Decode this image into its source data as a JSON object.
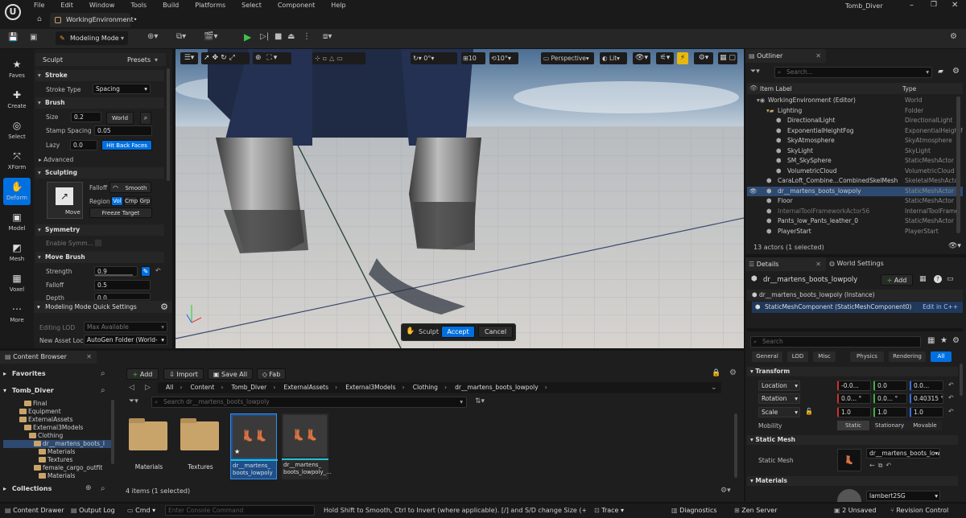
{
  "menu": {
    "items": [
      "File",
      "Edit",
      "Window",
      "Tools",
      "Build",
      "Platforms",
      "Select",
      "Component",
      "Help"
    ],
    "project": "Tomb_Diver",
    "tab": "WorkingEnvironment•"
  },
  "toolbar": {
    "mode": "Modeling Mode"
  },
  "left_tools": [
    "Faves",
    "Create",
    "Select",
    "XForm",
    "Deform",
    "Model",
    "Mesh",
    "Voxel",
    "More"
  ],
  "sculpt": {
    "title": "Sculpt",
    "presets": "Presets",
    "stroke": "Stroke",
    "stroke_type_label": "Stroke Type",
    "stroke_type": "Spacing",
    "brush": "Brush",
    "size_label": "Size",
    "size": "0.2",
    "world": "World",
    "stamp_label": "Stamp Spacing",
    "stamp": "0.05",
    "lazy_label": "Lazy",
    "lazy": "0.0",
    "hit_back": "Hit Back Faces",
    "advanced": "Advanced",
    "sculpting": "Sculpting",
    "falloff_label": "Falloff",
    "falloff_btn": "Smooth",
    "move": "Move",
    "region_label": "Region",
    "vol": "Vol",
    "cmp": "Cmp",
    "grp": "Grp",
    "freeze": "Freeze Target",
    "symmetry": "Symmetry",
    "enable_sym": "Enable Symm...",
    "move_brush": "Move Brush",
    "strength_label": "Strength",
    "strength": "0.9",
    "mb_falloff_label": "Falloff",
    "mb_falloff": "0.5",
    "depth_label": "Depth",
    "depth": "0.0",
    "quick": "Modeling Mode Quick Settings",
    "lod_label": "Editing LOD",
    "lod": "Max Available",
    "asset_label": "New Asset Loc",
    "asset": "AutoGen Folder (World-"
  },
  "viewport": {
    "snap_angle": "0°",
    "grid": "10",
    "rot": "10°",
    "perspective": "Perspective",
    "lit": "Lit",
    "sculpt": "Sculpt",
    "accept": "Accept",
    "cancel": "Cancel"
  },
  "outliner": {
    "title": "Outliner",
    "search": "Search...",
    "col_label": "Item Label",
    "col_type": "Type",
    "rows": [
      {
        "name": "WorkingEnvironment (Editor)",
        "type": "World",
        "indent": 0
      },
      {
        "name": "Lighting",
        "type": "Folder",
        "indent": 1
      },
      {
        "name": "DirectionalLight",
        "type": "DirectionalLight",
        "indent": 2
      },
      {
        "name": "ExponentialHeightFog",
        "type": "ExponentialHeightF",
        "indent": 2
      },
      {
        "name": "SkyAtmosphere",
        "type": "SkyAtmosphere",
        "indent": 2
      },
      {
        "name": "SkyLight",
        "type": "SkyLight",
        "indent": 2
      },
      {
        "name": "SM_SkySphere",
        "type": "StaticMeshActor",
        "indent": 2
      },
      {
        "name": "VolumetricCloud",
        "type": "VolumetricCloud",
        "indent": 2
      },
      {
        "name": "CaraLoft_Combine...CombinedSkelMesh",
        "type": "SkeletalMeshActor",
        "indent": 1
      },
      {
        "name": "dr__martens_boots_lowpoly",
        "type": "StaticMeshActor",
        "indent": 1
      },
      {
        "name": "Floor",
        "type": "StaticMeshActor",
        "indent": 1
      },
      {
        "name": "InternalToolFrameworkActor56",
        "type": "InternalToolFrame",
        "indent": 1
      },
      {
        "name": "Pants_low_Pants_leather_0",
        "type": "StaticMeshActor",
        "indent": 1
      },
      {
        "name": "PlayerStart",
        "type": "PlayerStart",
        "indent": 1
      }
    ],
    "footer": "13 actors (1 selected)"
  },
  "details": {
    "title": "Details",
    "world_settings": "World Settings",
    "actor": "dr__martens_boots_lowpoly",
    "add": "Add",
    "instance": "dr__martens_boots_lowpoly (Instance)",
    "component": "StaticMeshComponent (StaticMeshComponent0)",
    "edit_cpp": "Edit in C++",
    "search": "Search",
    "tabs": [
      "General",
      "LOD",
      "Misc",
      "Physics",
      "Rendering",
      "All"
    ],
    "transform": "Transform",
    "location": "Location",
    "rotation": "Rotation",
    "scale": "Scale",
    "loc": [
      "-0.0...",
      "0.0",
      "0.0..."
    ],
    "rot": [
      "0.0... °",
      "0.0... °",
      "0.40315 °"
    ],
    "scl": [
      "1.0",
      "1.0",
      "1.0"
    ],
    "mobility": "Mobility",
    "mob_opts": [
      "Static",
      "Stationary",
      "Movable"
    ],
    "static_mesh_sec": "Static Mesh",
    "static_mesh_label": "Static Mesh",
    "mesh": "dr__martens_boots_low",
    "materials": "Materials",
    "mat": "lambert2SG"
  },
  "content_browser": {
    "title": "Content Browser",
    "favorites": "Favorites",
    "root": "Tomb_Diver",
    "collections": "Collections",
    "tree": [
      {
        "name": "Final",
        "indent": 3
      },
      {
        "name": "Equipment",
        "indent": 2
      },
      {
        "name": "ExternalAssets",
        "indent": 2
      },
      {
        "name": "External3Models",
        "indent": 3
      },
      {
        "name": "Clothing",
        "indent": 4
      },
      {
        "name": "dr__martens_boots_l",
        "indent": 5
      },
      {
        "name": "Materials",
        "indent": 6
      },
      {
        "name": "Textures",
        "indent": 6
      },
      {
        "name": "female_cargo_outfit",
        "indent": 5
      },
      {
        "name": "Materials",
        "indent": 6
      }
    ],
    "add": "Add",
    "import": "Import",
    "save_all": "Save All",
    "fab": "Fab",
    "path": [
      "All",
      "Content",
      "Tomb_Diver",
      "ExternalAssets",
      "External3Models",
      "Clothing",
      "dr__martens_boots_lowpoly"
    ],
    "search": "Search dr__martens_boots_lowpoly",
    "assets": [
      {
        "name": "Materials"
      },
      {
        "name": "Textures"
      },
      {
        "name": "dr__martens_\nboots_lowpoly"
      },
      {
        "name": "dr__martens_\nboots_lowpoly_..."
      }
    ],
    "count": "4 items (1 selected)"
  },
  "status": {
    "drawer": "Content Drawer",
    "output": "Output Log",
    "cmd": "Cmd",
    "console": "Enter Console Command",
    "hint": "Hold Shift to Smooth, Ctrl to Invert (where applicable). [/] and S/D change Size (+Shift to",
    "trace": "Trace",
    "diag": "Diagnostics",
    "zen": "Zen Server",
    "unsaved": "2 Unsaved",
    "rev": "Revision Control"
  }
}
